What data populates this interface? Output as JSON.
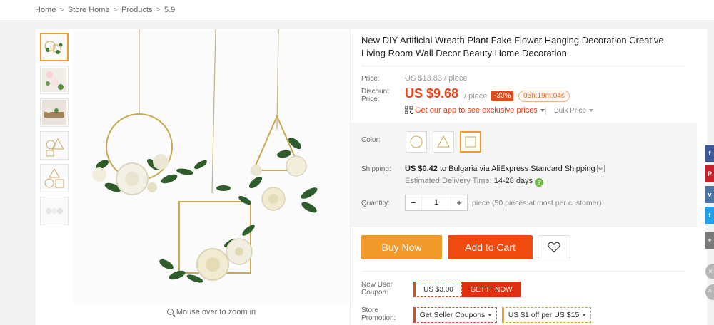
{
  "breadcrumb": {
    "items": [
      "Home",
      "Store Home",
      "Products",
      "5.9"
    ],
    "separator": ">"
  },
  "gallery": {
    "thumbnail_names": [
      "hanging-wreath-thumb",
      "flower-garland-thumb",
      "flower-shelf-thumb",
      "metal-frames-thumb",
      "circle-triangle-square-thumb",
      "white-flowers-thumb"
    ],
    "active_index": 0,
    "zoom_hint": "Mouse over to zoom in"
  },
  "product": {
    "title": "New DIY Artificial Wreath Plant Fake Flower Hanging Decoration Creative Living Room Wall Decor Beauty Home Decoration"
  },
  "pricing": {
    "price_label": "Price:",
    "original_price": "US $13.83 / piece",
    "discount_label": "Discount Price:",
    "discount_price": "US $9.68",
    "per_piece": "/ piece",
    "discount_badge": "-30%",
    "countdown": "05h:19m:04s",
    "app_promo": "Get our app to see exclusive prices",
    "bulk_price": "Bulk Price"
  },
  "options": {
    "color_label": "Color:",
    "colors": [
      "circle-frame",
      "triangle-frame",
      "square-frame"
    ],
    "selected_color_index": 2,
    "shipping_label": "Shipping:",
    "shipping_cost": "US $0.42",
    "shipping_to": "to Bulgaria via",
    "shipping_method": "AliExpress Standard Shipping",
    "delivery_label": "Estimated Delivery Time:",
    "delivery_days": "14-28 days",
    "quantity_label": "Quantity:",
    "quantity_value": "1",
    "quantity_minus": "−",
    "quantity_plus": "+",
    "quantity_note": "piece (50 pieces at most per customer)"
  },
  "actions": {
    "buy_now": "Buy Now",
    "add_to_cart": "Add to Cart"
  },
  "coupons": {
    "new_user_label": "New User Coupon:",
    "new_user_amount": "US $3.00",
    "get_it_now": "GET IT NOW",
    "store_promo_label": "Store Promotion:",
    "seller_coupons": "Get Seller Coupons",
    "store_offer": "US $1 off per US $15"
  },
  "social": {
    "icons": [
      "facebook-icon",
      "pinterest-icon",
      "vk-icon",
      "twitter-icon",
      "share-icon"
    ],
    "colors": [
      "#3b5998",
      "#cb2027",
      "#4c75a3",
      "#1da1f2",
      "#7a7a7a"
    ]
  },
  "colors": {
    "accent_orange": "#f29a27",
    "cart_red": "#f04a0e",
    "price_red": "#f0441a"
  }
}
